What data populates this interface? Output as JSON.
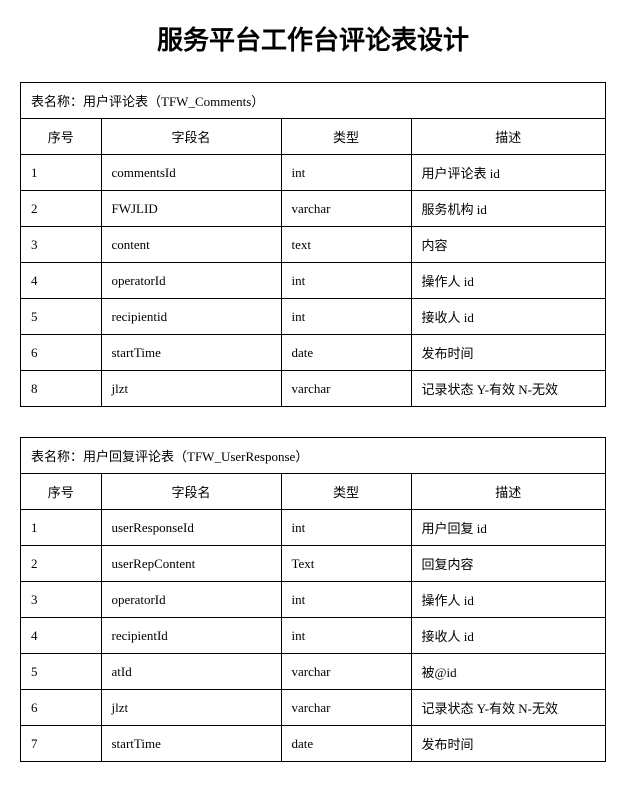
{
  "title": "服务平台工作台评论表设计",
  "tables": [
    {
      "label": "表名称：用户评论表（TFW_Comments）",
      "headers": [
        "序号",
        "字段名",
        "类型",
        "描述"
      ],
      "rows": [
        [
          "1",
          "commentsId",
          "int",
          "用户评论表 id"
        ],
        [
          "2",
          "FWJLID",
          "varchar",
          "服务机构 id"
        ],
        [
          "3",
          "content",
          "text",
          "内容"
        ],
        [
          "4",
          "operatorId",
          "int",
          "操作人 id"
        ],
        [
          "5",
          "recipientid",
          "int",
          "接收人 id"
        ],
        [
          "6",
          "startTime",
          "date",
          "发布时间"
        ],
        [
          "8",
          "jlzt",
          "varchar",
          "记录状态 Y-有效 N-无效"
        ]
      ]
    },
    {
      "label": "表名称：用户回复评论表（TFW_UserResponse）",
      "headers": [
        "序号",
        "字段名",
        "类型",
        "描述"
      ],
      "rows": [
        [
          "1",
          "userResponseId",
          "int",
          "用户回复 id"
        ],
        [
          "2",
          "userRepContent",
          "Text",
          "回复内容"
        ],
        [
          "3",
          "operatorId",
          "int",
          "操作人 id"
        ],
        [
          "4",
          "recipientId",
          "int",
          "接收人 id"
        ],
        [
          "5",
          "atId",
          "varchar",
          "被@id"
        ],
        [
          "6",
          "jlzt",
          "varchar",
          "记录状态 Y-有效 N-无效"
        ],
        [
          "7",
          "startTime",
          "date",
          "发布时间"
        ]
      ]
    }
  ]
}
